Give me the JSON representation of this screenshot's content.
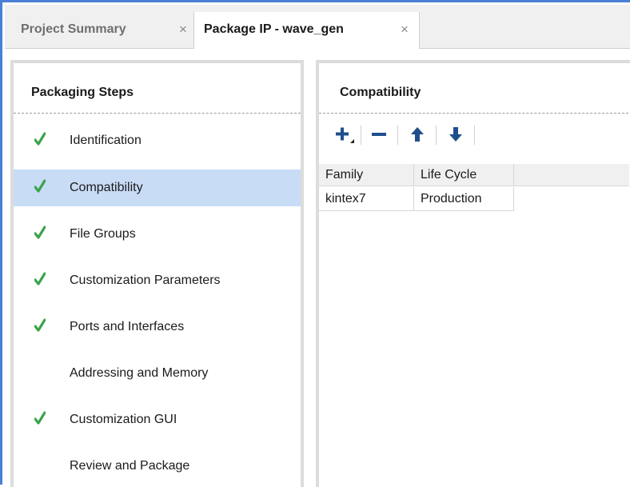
{
  "tabs": [
    {
      "label": "Project Summary",
      "close": "×",
      "active": false
    },
    {
      "label": "Package IP - wave_gen",
      "close": "×",
      "active": true
    }
  ],
  "packaging_steps": {
    "title": "Packaging Steps",
    "items": [
      {
        "label": "Identification",
        "done": true
      },
      {
        "label": "Compatibility",
        "done": true,
        "selected": true
      },
      {
        "label": "File Groups",
        "done": true
      },
      {
        "label": "Customization Parameters",
        "done": true
      },
      {
        "label": "Ports and Interfaces",
        "done": true
      },
      {
        "label": "Addressing and Memory",
        "done": false
      },
      {
        "label": "Customization GUI",
        "done": true
      },
      {
        "label": "Review and Package",
        "done": false
      }
    ]
  },
  "compatibility": {
    "title": "Compatibility",
    "toolbar": {
      "add": "plus-dropdown-icon",
      "remove": "minus-icon",
      "move_up": "arrow-up-icon",
      "move_down": "arrow-down-icon"
    },
    "columns": [
      "Family",
      "Life Cycle"
    ],
    "rows": [
      [
        "kintex7",
        "Production"
      ]
    ]
  },
  "colors": {
    "accent": "#4a7fd4",
    "selected_row": "#c8dcf6",
    "check_green": "#3aa34a",
    "toolbar_blue": "#1f4e8c"
  }
}
